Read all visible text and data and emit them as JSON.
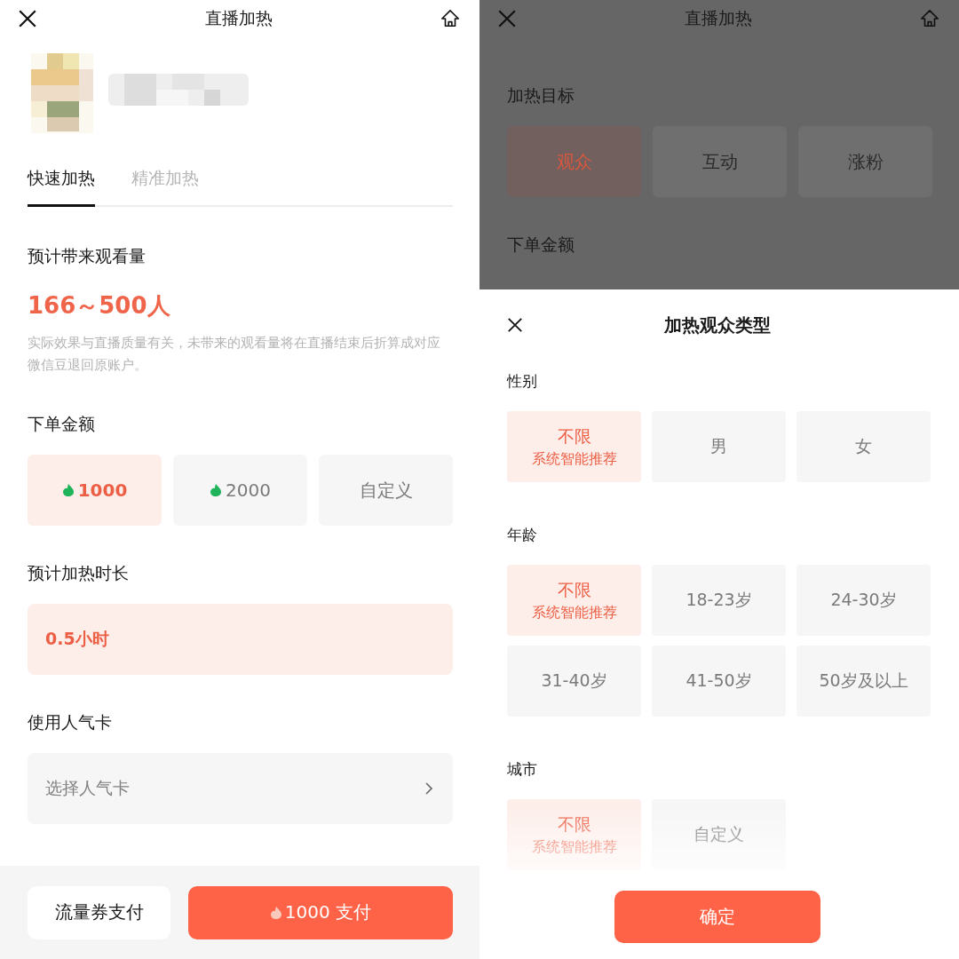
{
  "left": {
    "header": {
      "title": "直播加热"
    },
    "tabs": [
      {
        "label": "快速加热",
        "selected": true
      },
      {
        "label": "精准加热",
        "selected": false
      }
    ],
    "estimate": {
      "label": "预计带来观看量",
      "value": "166～500人",
      "note": "实际效果与直播质量有关，未带来的观看量将在直播结束后折算成对应微信豆退回原账户。"
    },
    "amount": {
      "label": "下单金额",
      "options": [
        {
          "kind": "bean",
          "label": "1000",
          "selected": true
        },
        {
          "kind": "bean",
          "label": "2000",
          "selected": false
        },
        {
          "kind": "text",
          "label": "自定义",
          "selected": false
        }
      ]
    },
    "duration": {
      "label": "预计加热时长",
      "value": "0.5小时"
    },
    "card": {
      "label": "使用人气卡",
      "prompt": "选择人气卡"
    },
    "footer": {
      "secondary": "流量券支付",
      "primary": "1000 支付"
    }
  },
  "right": {
    "header": {
      "title": "直播加热"
    },
    "goal": {
      "label": "加热目标",
      "options": [
        {
          "label": "观众",
          "selected": true
        },
        {
          "label": "互动",
          "selected": false
        },
        {
          "label": "涨粉",
          "selected": false
        }
      ]
    },
    "amount_label": "下单金额",
    "sheet": {
      "title": "加热观众类型",
      "groups": [
        {
          "label": "性别",
          "faded": false,
          "options": [
            {
              "label": "不限",
              "hint": "系统智能推荐",
              "selected": true
            },
            {
              "label": "男",
              "selected": false
            },
            {
              "label": "女",
              "selected": false
            }
          ]
        },
        {
          "label": "年龄",
          "faded": false,
          "options": [
            {
              "label": "不限",
              "hint": "系统智能推荐",
              "selected": true
            },
            {
              "label": "18-23岁",
              "selected": false
            },
            {
              "label": "24-30岁",
              "selected": false
            },
            {
              "label": "31-40岁",
              "selected": false
            },
            {
              "label": "41-50岁",
              "selected": false
            },
            {
              "label": "50岁及以上",
              "selected": false
            }
          ]
        },
        {
          "label": "城市",
          "faded": true,
          "options": [
            {
              "label": "不限",
              "hint": "系统智能推荐",
              "selected": true
            },
            {
              "label": "自定义",
              "selected": false
            }
          ]
        }
      ],
      "confirm": "确定"
    }
  }
}
